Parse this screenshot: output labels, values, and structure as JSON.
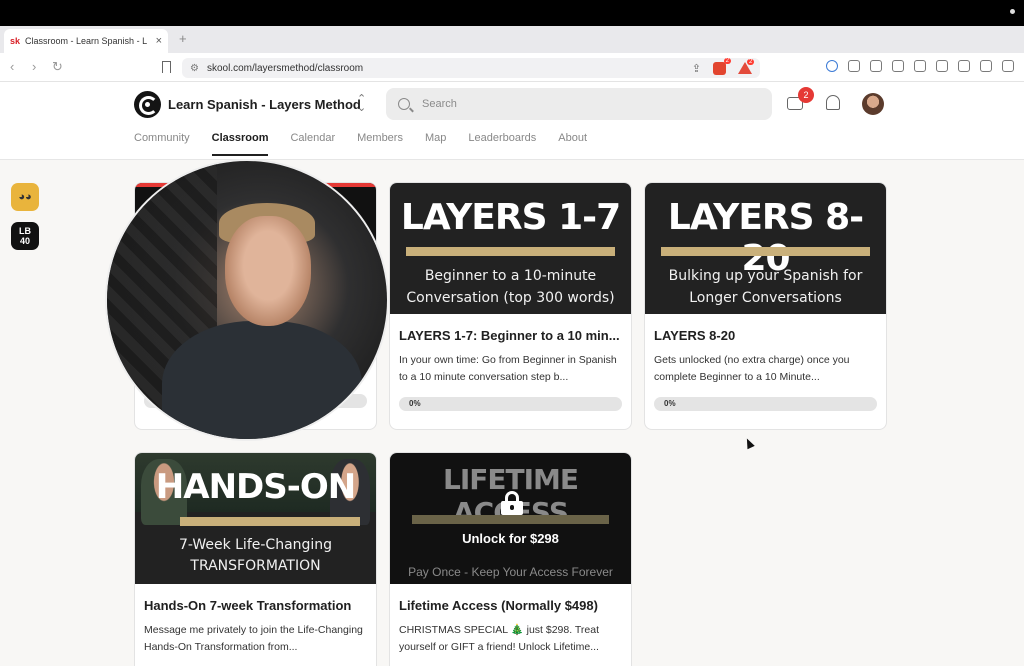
{
  "browser": {
    "tab_title": "Classroom - Learn Spanish - L",
    "tab_favicon": "sk",
    "url": "skool.com/layersmethod/classroom",
    "shield_badge": "2",
    "alert_badge": "2"
  },
  "header": {
    "group_name": "Learn Spanish - Layers Method",
    "search_placeholder": "Search",
    "chat_badge": "2"
  },
  "nav": {
    "tabs": [
      {
        "label": "Community"
      },
      {
        "label": "Classroom"
      },
      {
        "label": "Calendar"
      },
      {
        "label": "Members"
      },
      {
        "label": "Map"
      },
      {
        "label": "Leaderboards"
      },
      {
        "label": "About"
      }
    ],
    "active": "Classroom"
  },
  "side": {
    "lb_label": "LB\n40"
  },
  "courses": [
    {
      "thumb_title": "",
      "thumb_sub": "",
      "title": "",
      "desc": "",
      "progress_label": "",
      "progress": 0
    },
    {
      "thumb_title": "LAYERS 1-7",
      "thumb_sub": "Beginner to a 10-minute Conversation (top 300 words)",
      "title": "LAYERS 1-7: Beginner to a 10 min...",
      "desc": "In your own time: Go from Beginner in Spanish to a 10 minute conversation step b...",
      "progress_label": "0%",
      "progress": 0
    },
    {
      "thumb_title": "LAYERS 8-20",
      "thumb_sub": "Bulking up your Spanish for Longer Conversations",
      "title": "LAYERS 8-20",
      "desc": "Gets unlocked (no extra charge) once you complete Beginner to a 10 Minute...",
      "progress_label": "0%",
      "progress": 0
    },
    {
      "thumb_title": "HANDS-ON",
      "thumb_sub": "7-Week Life-Changing TRANSFORMATION",
      "title": "Hands-On 7-week Transformation",
      "desc": "Message me privately to join the Life-Changing Hands-On Transformation from..."
    },
    {
      "thumb_title": "LIFETIME ACCESS",
      "thumb_unlock": "Unlock for $298",
      "thumb_sub": "Pay Once - Keep Your Access Forever",
      "title": "Lifetime Access (Normally $498)",
      "desc": "CHRISTMAS SPECIAL 🎄 just $298. Treat yourself or GIFT a friend! Unlock Lifetime..."
    }
  ],
  "colors": {
    "accent_bar": "#c9b07a",
    "badge": "#e53935"
  },
  "icons": [
    "back-icon",
    "forward-icon",
    "reload-icon",
    "bookmark-icon",
    "share-icon",
    "search-icon",
    "chat-icon",
    "bell-icon",
    "lock-icon"
  ]
}
